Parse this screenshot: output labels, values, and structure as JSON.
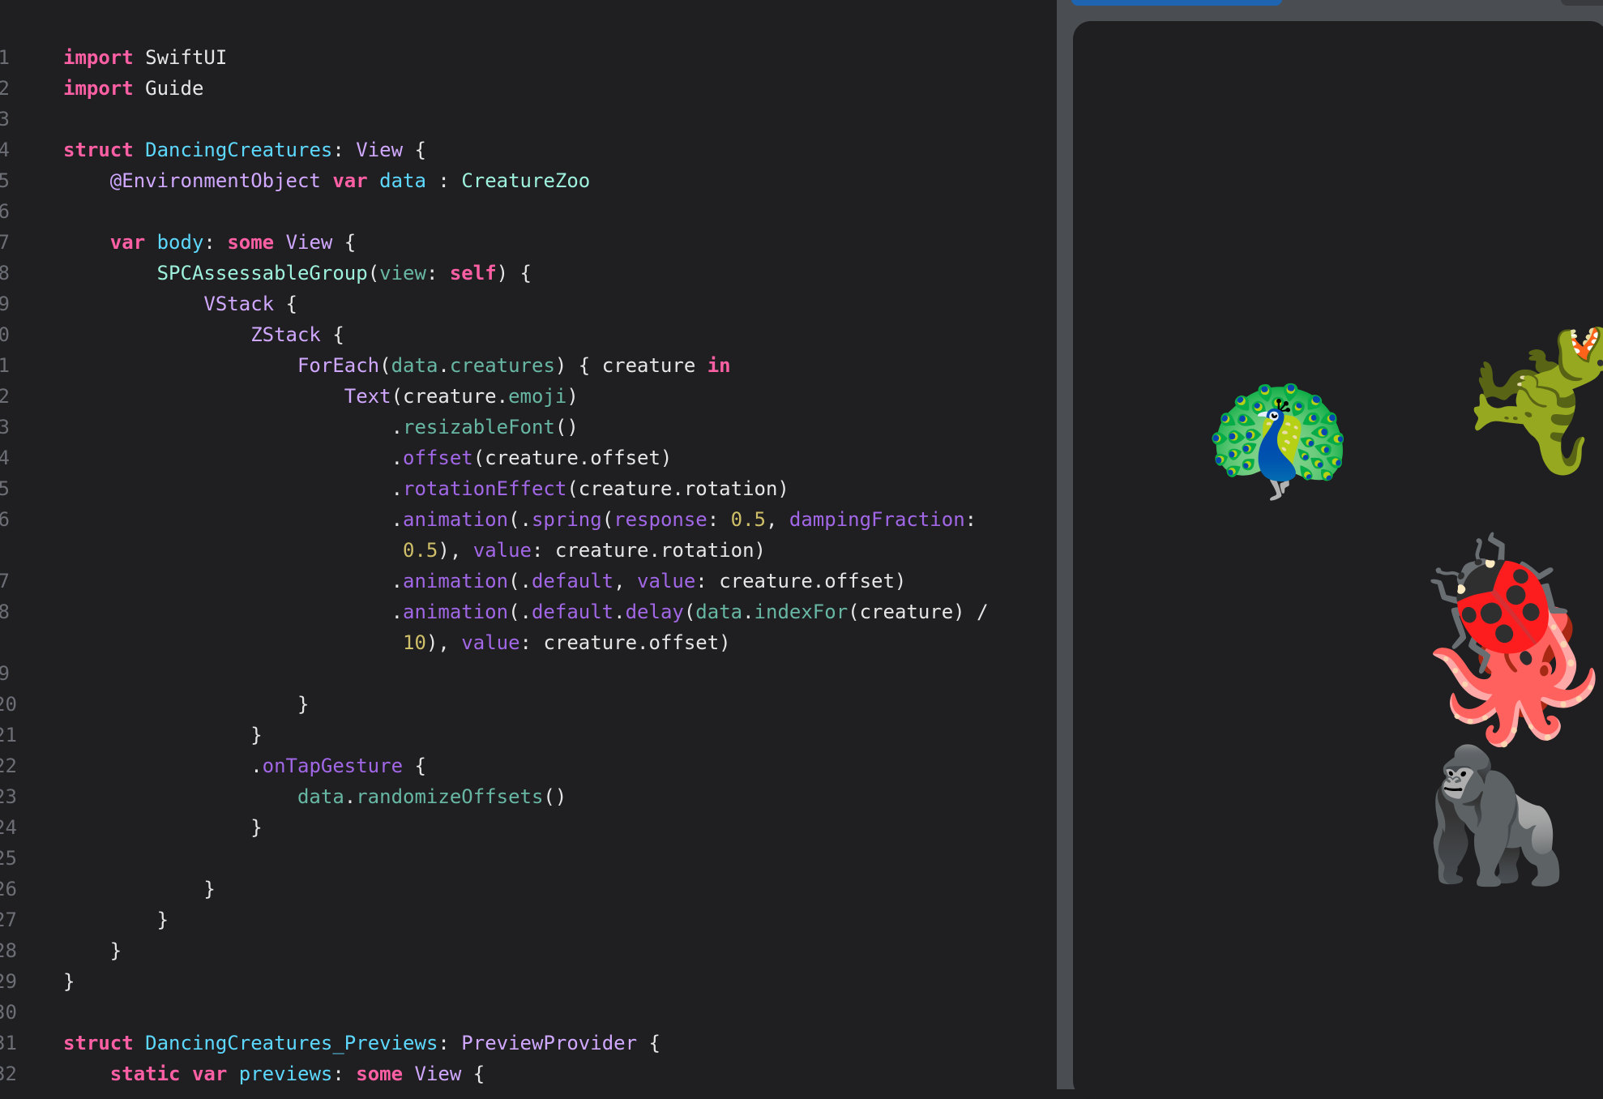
{
  "colors": {
    "keyword": "#fc5fa3",
    "type_decl": "#5dd8ff",
    "type_ref": "#d0a8ff",
    "property": "#67b7a4",
    "method": "#a167e6",
    "number": "#d0bf69",
    "plain": "#e6e6e6",
    "active_tab": "#1f64b0"
  },
  "editor": {
    "lines": [
      {
        "n": "1",
        "tokens": [
          [
            "kw",
            "import"
          ],
          [
            "pl",
            " SwiftUI"
          ]
        ]
      },
      {
        "n": "2",
        "tokens": [
          [
            "kw",
            "import"
          ],
          [
            "pl",
            " Guide"
          ]
        ]
      },
      {
        "n": "3",
        "tokens": []
      },
      {
        "n": "4",
        "tokens": [
          [
            "kw",
            "struct"
          ],
          [
            "pl",
            " "
          ],
          [
            "ty",
            "DancingCreatures"
          ],
          [
            "pl",
            ": "
          ],
          [
            "cl",
            "View"
          ],
          [
            "pl",
            " {"
          ]
        ]
      },
      {
        "n": "5",
        "tokens": [
          [
            "pl",
            "    "
          ],
          [
            "cl",
            "@EnvironmentObject"
          ],
          [
            "pl",
            " "
          ],
          [
            "kw",
            "var"
          ],
          [
            "pl",
            " "
          ],
          [
            "ty",
            "data"
          ],
          [
            "pl",
            " : "
          ],
          [
            "tyb",
            "CreatureZoo"
          ]
        ]
      },
      {
        "n": "6",
        "tokens": []
      },
      {
        "n": "7",
        "tokens": [
          [
            "pl",
            "    "
          ],
          [
            "kw",
            "var"
          ],
          [
            "pl",
            " "
          ],
          [
            "ty",
            "body"
          ],
          [
            "pl",
            ": "
          ],
          [
            "kw",
            "some"
          ],
          [
            "pl",
            " "
          ],
          [
            "cl",
            "View"
          ],
          [
            "pl",
            " {"
          ]
        ]
      },
      {
        "n": "8",
        "tokens": [
          [
            "pl",
            "        "
          ],
          [
            "tyb",
            "SPCAssessableGroup"
          ],
          [
            "pl",
            "("
          ],
          [
            "pr",
            "view"
          ],
          [
            "pl",
            ": "
          ],
          [
            "kw",
            "self"
          ],
          [
            "pl",
            ") {"
          ]
        ]
      },
      {
        "n": "9",
        "tokens": [
          [
            "pl",
            "            "
          ],
          [
            "cl",
            "VStack"
          ],
          [
            "pl",
            " {"
          ]
        ]
      },
      {
        "n": "0",
        "tokens": [
          [
            "pl",
            "                "
          ],
          [
            "cl",
            "ZStack"
          ],
          [
            "pl",
            " {"
          ]
        ]
      },
      {
        "n": "1",
        "tokens": [
          [
            "pl",
            "                    "
          ],
          [
            "cl",
            "ForEach"
          ],
          [
            "pl",
            "("
          ],
          [
            "pr",
            "data"
          ],
          [
            "pl",
            "."
          ],
          [
            "pr",
            "creatures"
          ],
          [
            "pl",
            ") { creature "
          ],
          [
            "kw",
            "in"
          ]
        ]
      },
      {
        "n": "2",
        "tokens": [
          [
            "pl",
            "                        "
          ],
          [
            "cl",
            "Text"
          ],
          [
            "pl",
            "(creature."
          ],
          [
            "pr",
            "emoji"
          ],
          [
            "pl",
            ")"
          ]
        ]
      },
      {
        "n": "3",
        "tokens": [
          [
            "pl",
            "                            ."
          ],
          [
            "fn",
            "resizableFont"
          ],
          [
            "pl",
            "()"
          ]
        ]
      },
      {
        "n": "4",
        "tokens": [
          [
            "pl",
            "                            ."
          ],
          [
            "md",
            "offset"
          ],
          [
            "pl",
            "(creature.offset)"
          ]
        ]
      },
      {
        "n": "5",
        "tokens": [
          [
            "pl",
            "                            ."
          ],
          [
            "md",
            "rotationEffect"
          ],
          [
            "pl",
            "(creature.rotation)"
          ]
        ]
      },
      {
        "n": "6",
        "tokens": [
          [
            "pl",
            "                            ."
          ],
          [
            "md",
            "animation"
          ],
          [
            "pl",
            "(."
          ],
          [
            "md",
            "spring"
          ],
          [
            "pl",
            "("
          ],
          [
            "lb",
            "response"
          ],
          [
            "pl",
            ": "
          ],
          [
            "nu",
            "0.5"
          ],
          [
            "pl",
            ", "
          ],
          [
            "lb",
            "dampingFraction"
          ],
          [
            "pl",
            ":"
          ]
        ]
      },
      {
        "n": "",
        "tokens": [
          [
            "pl",
            "                             "
          ],
          [
            "nu",
            "0.5"
          ],
          [
            "pl",
            "), "
          ],
          [
            "lb",
            "value"
          ],
          [
            "pl",
            ": creature.rotation)"
          ]
        ]
      },
      {
        "n": "7",
        "tokens": [
          [
            "pl",
            "                            ."
          ],
          [
            "md",
            "animation"
          ],
          [
            "pl",
            "(."
          ],
          [
            "md",
            "default"
          ],
          [
            "pl",
            ", "
          ],
          [
            "lb",
            "value"
          ],
          [
            "pl",
            ": creature.offset)"
          ]
        ]
      },
      {
        "n": "8",
        "tokens": [
          [
            "pl",
            "                            ."
          ],
          [
            "md",
            "animation"
          ],
          [
            "pl",
            "(."
          ],
          [
            "md",
            "default"
          ],
          [
            "pl",
            "."
          ],
          [
            "md",
            "delay"
          ],
          [
            "pl",
            "("
          ],
          [
            "pr",
            "data"
          ],
          [
            "pl",
            "."
          ],
          [
            "fn",
            "indexFor"
          ],
          [
            "pl",
            "(creature) /"
          ]
        ]
      },
      {
        "n": "",
        "tokens": [
          [
            "pl",
            "                             "
          ],
          [
            "nu",
            "10"
          ],
          [
            "pl",
            "), "
          ],
          [
            "lb",
            "value"
          ],
          [
            "pl",
            ": creature.offset)"
          ]
        ]
      },
      {
        "n": "9",
        "tokens": []
      },
      {
        "n": "20",
        "tokens": [
          [
            "pl",
            "                    }"
          ]
        ]
      },
      {
        "n": "21",
        "tokens": [
          [
            "pl",
            "                }"
          ]
        ]
      },
      {
        "n": "22",
        "tokens": [
          [
            "pl",
            "                ."
          ],
          [
            "md",
            "onTapGesture"
          ],
          [
            "pl",
            " {"
          ]
        ]
      },
      {
        "n": "23",
        "tokens": [
          [
            "pl",
            "                    "
          ],
          [
            "pr",
            "data"
          ],
          [
            "pl",
            "."
          ],
          [
            "fn",
            "randomizeOffsets"
          ],
          [
            "pl",
            "()"
          ]
        ]
      },
      {
        "n": "24",
        "tokens": [
          [
            "pl",
            "                }"
          ]
        ]
      },
      {
        "n": "25",
        "tokens": []
      },
      {
        "n": "26",
        "tokens": [
          [
            "pl",
            "            }"
          ]
        ]
      },
      {
        "n": "27",
        "tokens": [
          [
            "pl",
            "        }"
          ]
        ]
      },
      {
        "n": "28",
        "tokens": [
          [
            "pl",
            "    }"
          ]
        ]
      },
      {
        "n": "29",
        "tokens": [
          [
            "pl",
            "}"
          ]
        ]
      },
      {
        "n": "30",
        "tokens": []
      },
      {
        "n": "31",
        "tokens": [
          [
            "kw",
            "struct"
          ],
          [
            "pl",
            " "
          ],
          [
            "ty",
            "DancingCreatures_Previews"
          ],
          [
            "pl",
            ": "
          ],
          [
            "cl",
            "PreviewProvider"
          ],
          [
            "pl",
            " {"
          ]
        ]
      },
      {
        "n": "32",
        "tokens": [
          [
            "pl",
            "    "
          ],
          [
            "kw",
            "static"
          ],
          [
            "pl",
            " "
          ],
          [
            "kw",
            "var"
          ],
          [
            "pl",
            " "
          ],
          [
            "ty",
            "previews"
          ],
          [
            "pl",
            ": "
          ],
          [
            "kw",
            "some"
          ],
          [
            "pl",
            " "
          ],
          [
            "cl",
            "View"
          ],
          [
            "pl",
            " {"
          ]
        ]
      }
    ]
  },
  "preview": {
    "creatures": [
      {
        "name": "peacock",
        "emoji": "🦚"
      },
      {
        "name": "t-rex",
        "emoji": "🦖"
      },
      {
        "name": "ladybug",
        "emoji": "🐞"
      },
      {
        "name": "octopus",
        "emoji": "🐙"
      },
      {
        "name": "gorilla",
        "emoji": "🦍"
      }
    ]
  }
}
